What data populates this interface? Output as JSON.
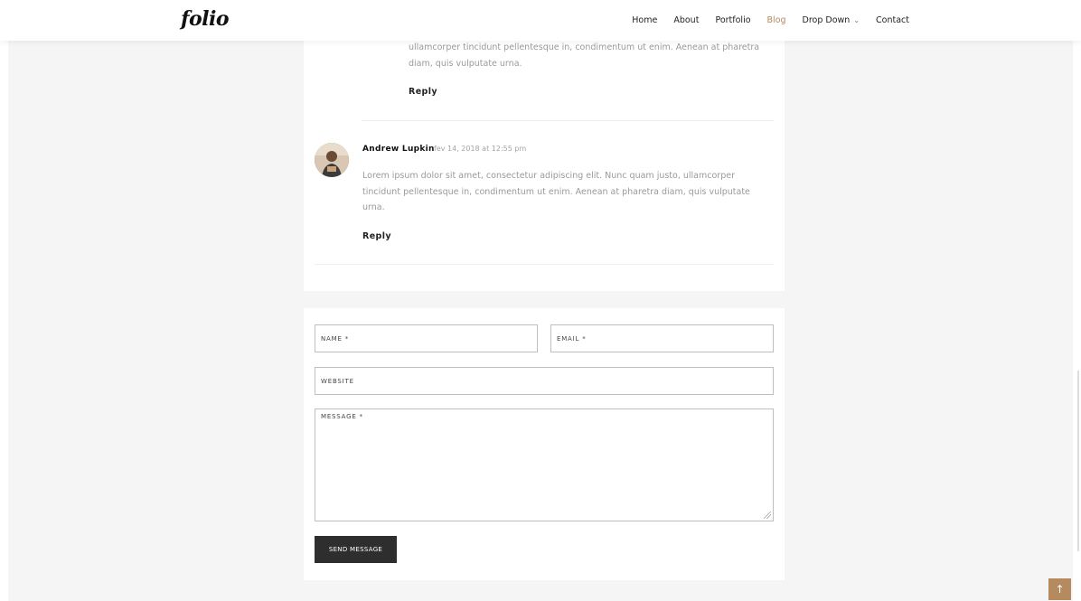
{
  "header": {
    "logo": "folio",
    "nav": [
      {
        "label": "Home",
        "active": false
      },
      {
        "label": "About",
        "active": false
      },
      {
        "label": "Portfolio",
        "active": false
      },
      {
        "label": "Blog",
        "active": true
      },
      {
        "label": "Drop Down",
        "active": false,
        "has_dropdown": true
      },
      {
        "label": "Contact",
        "active": false
      }
    ],
    "accent_color": "#b58a5e"
  },
  "comments": {
    "reply_comment": {
      "text_line_1": "ullamcorper tincidunt pellentesque in, condimentum ut enim. Aenean at pharetra",
      "text_line_2": "diam, quis vulputate urna.",
      "reply_label": "Reply"
    },
    "comment": {
      "author": "Andrew Lupkin",
      "date": "fev 14, 2018 at 12:55 pm",
      "text_line_1": "Lorem ipsum dolor sit amet, consectetur adipiscing elit. Nunc quam justo, ullamcorper",
      "text_line_2": "tincidunt pellentesque in, condimentum ut enim. Aenean at pharetra diam, quis vulputate",
      "text_line_3": "urna.",
      "reply_label": "Reply"
    }
  },
  "form": {
    "name_label": "NAME *",
    "email_label": "EMAIL *",
    "website_label": "WEBSITE",
    "message_label": "MESSAGE *",
    "submit_label": "SEND MESSAGE"
  },
  "back_to_top_icon": "arrow-up-icon"
}
